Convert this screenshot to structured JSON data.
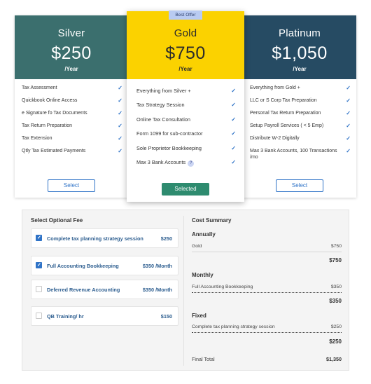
{
  "plans": [
    {
      "name": "Silver",
      "price": "$250",
      "period": "/Year",
      "features": [
        "Tax Assessment",
        "Quickbook Online Access",
        "e Signature fo Tax Documents",
        "Tax Return Preparation",
        "Tax Extension",
        "Qtly Tax Estimated Payments"
      ],
      "button": "Select"
    },
    {
      "name": "Gold",
      "badge": "Best Offer",
      "price": "$750",
      "period": "/Year",
      "features": [
        "Everything from Silver +",
        "Tax Strategy Session",
        "Online Tax Consultation",
        "Form 1099 for sub-contractor",
        "Sole Proprietor Bookkeeping",
        "Max 3 Bank Accounts"
      ],
      "help_icon": "?",
      "button": "Selected"
    },
    {
      "name": "Platinum",
      "price": "$1,050",
      "period": "/Year",
      "features": [
        "Everything from Gold +",
        "LLC or S Corp Tax Preparation",
        "Personal Tax Return Preparation",
        "Setup Payroll Services ( < 5 Emp)",
        "Distribute W-2 Digitally",
        "Max 3 Bank Accounts, 100 Transactions /mo"
      ],
      "button": "Select"
    }
  ],
  "optional_fees": {
    "title": "Select Optional Fee",
    "items": [
      {
        "label": "Complete tax planning strategy session",
        "price": "$250",
        "checked": true
      },
      {
        "label": "Full Accounting Bookkeeping",
        "price": "$350 /Month",
        "checked": true
      },
      {
        "label": "Deferred Revenue Accounting",
        "price": "$350 /Month",
        "checked": false
      },
      {
        "label": "QB Training/ hr",
        "price": "$150",
        "checked": false
      }
    ]
  },
  "cost_summary": {
    "title": "Cost Summary",
    "annually": {
      "label": "Annually",
      "item": "Gold",
      "item_price": "$750",
      "subtotal": "$750"
    },
    "monthly": {
      "label": "Monthly",
      "item": "Full Accounting Bookkeeping",
      "item_price": "$350",
      "subtotal": "$350"
    },
    "fixed": {
      "label": "Fixed",
      "item": "Complete tax planning strategy session",
      "item_price": "$250",
      "subtotal": "$250"
    },
    "final_label": "Final Total",
    "final_value": "$1,350"
  },
  "colors": {
    "silver": "#3b6f6e",
    "gold": "#fbd200",
    "platinum": "#264b63",
    "accent_blue": "#2f73c7",
    "selected_green": "#2e8b6f"
  }
}
